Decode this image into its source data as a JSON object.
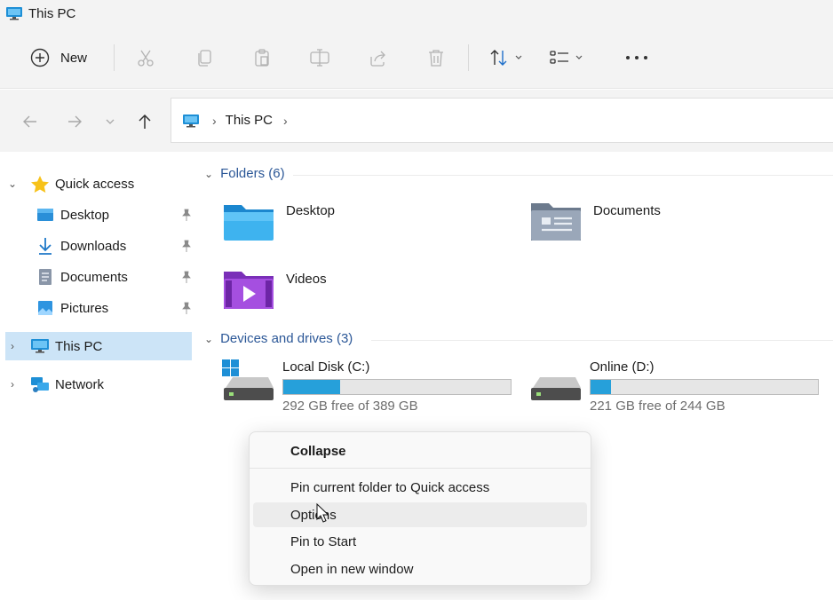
{
  "window": {
    "title": "This PC"
  },
  "toolbar": {
    "new_label": "New"
  },
  "address": {
    "crumbs": [
      "This PC"
    ]
  },
  "sidebar": {
    "quick_access": "Quick access",
    "items": [
      {
        "label": "Desktop"
      },
      {
        "label": "Downloads"
      },
      {
        "label": "Documents"
      },
      {
        "label": "Pictures"
      }
    ],
    "this_pc": "This PC",
    "network": "Network"
  },
  "content": {
    "folders_header": "Folders (6)",
    "folders": [
      {
        "name": "Desktop"
      },
      {
        "name": "Documents"
      },
      {
        "name": "Videos"
      }
    ],
    "drives_header": "Devices and drives (3)",
    "drives": [
      {
        "name": "Local Disk (C:)",
        "free_text": "292 GB free of 389 GB",
        "used_fraction": 0.25
      },
      {
        "name": "Online (D:)",
        "free_text": "221 GB free of 244 GB",
        "used_fraction": 0.09
      }
    ]
  },
  "context_menu": {
    "items": [
      {
        "label": "Collapse"
      },
      {
        "label": "Pin current folder to Quick access"
      },
      {
        "label": "Options"
      },
      {
        "label": "Pin to Start"
      },
      {
        "label": "Open in new window"
      }
    ]
  },
  "colors": {
    "accent": "#26a0da",
    "selected": "#cce4f7",
    "section_header": "#2b5797"
  }
}
